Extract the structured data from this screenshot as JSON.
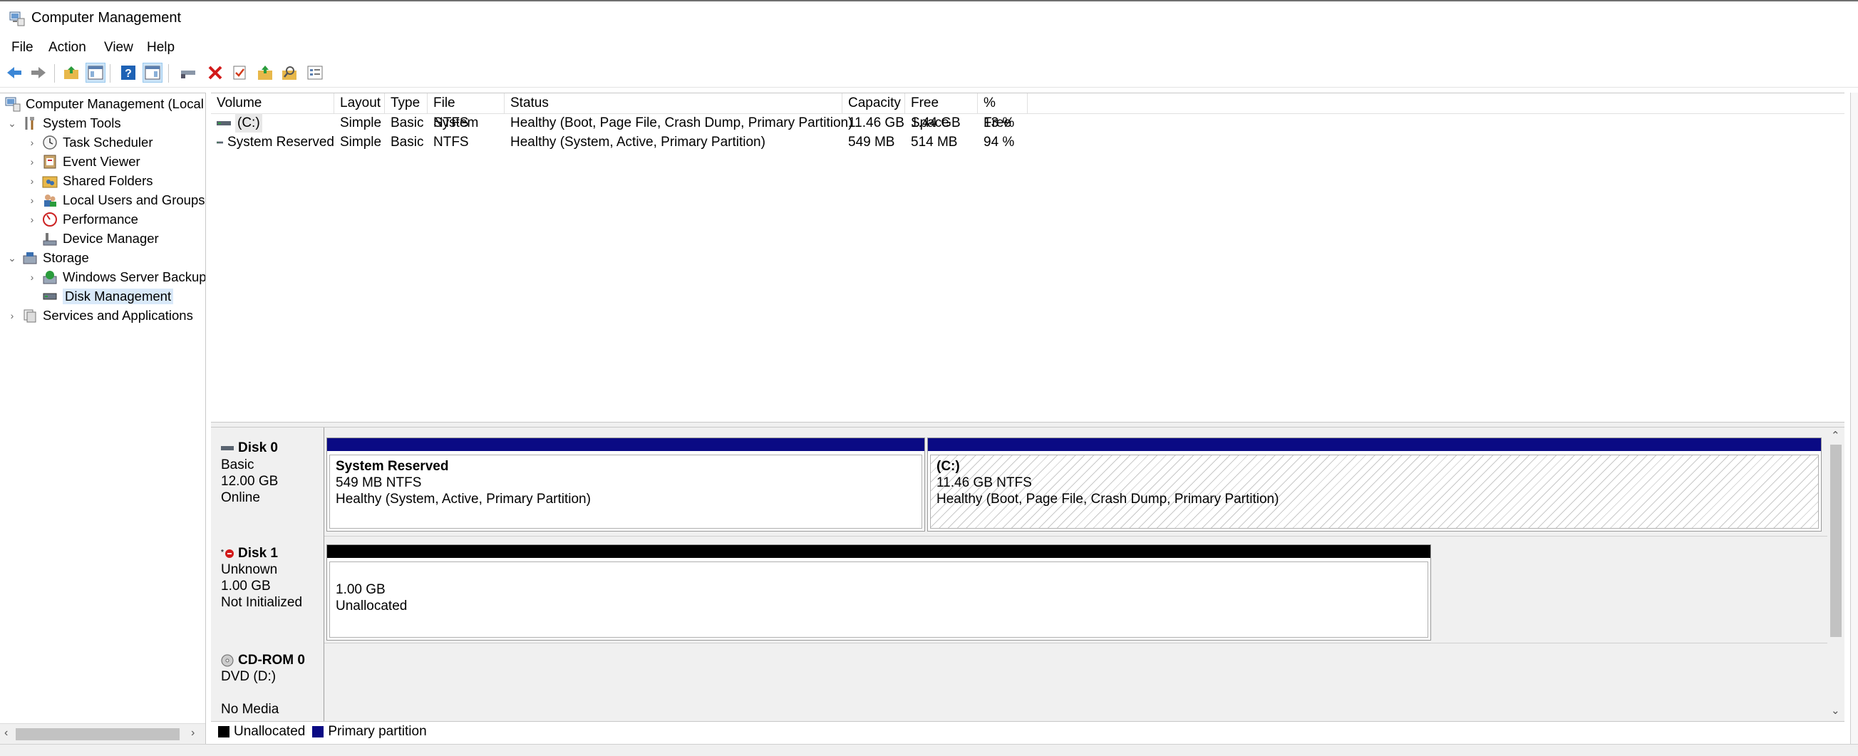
{
  "window": {
    "title": "Computer Management"
  },
  "menu": [
    "File",
    "Action",
    "View",
    "Help"
  ],
  "toolbar": {
    "buttons": [
      "back-icon",
      "forward-icon",
      "up-folder-icon",
      "show-hide-tree-icon",
      "help-icon",
      "show-hide-action-pane-icon",
      "connect-icon",
      "delete-icon",
      "check-icon",
      "export-folder-icon",
      "find-folder-icon",
      "properties-icon"
    ]
  },
  "tree": {
    "root": "Computer Management (Local",
    "system_tools": "System Tools",
    "task_scheduler": "Task Scheduler",
    "event_viewer": "Event Viewer",
    "shared_folders": "Shared Folders",
    "local_users": "Local Users and Groups",
    "performance": "Performance",
    "device_manager": "Device Manager",
    "storage": "Storage",
    "windows_backup": "Windows Server Backup",
    "disk_management": "Disk Management",
    "services": "Services and Applications"
  },
  "volumes": {
    "columns": [
      "Volume",
      "Layout",
      "Type",
      "File System",
      "Status",
      "Capacity",
      "Free Space",
      "% Free"
    ],
    "rows": [
      {
        "volume": "(C:)",
        "layout": "Simple",
        "type": "Basic",
        "fs": "NTFS",
        "status": "Healthy (Boot, Page File, Crash Dump, Primary Partition)",
        "capacity": "11.46 GB",
        "free": "1.44 GB",
        "pct": "13 %"
      },
      {
        "volume": "System Reserved",
        "layout": "Simple",
        "type": "Basic",
        "fs": "NTFS",
        "status": "Healthy (System, Active, Primary Partition)",
        "capacity": "549 MB",
        "free": "514 MB",
        "pct": "94 %"
      }
    ]
  },
  "disks": {
    "disk0": {
      "name": "Disk 0",
      "type": "Basic",
      "size": "12.00 GB",
      "status": "Online",
      "p1": {
        "name": "System Reserved",
        "size": "549 MB NTFS",
        "status": "Healthy (System, Active, Primary Partition)"
      },
      "p2": {
        "name": "(C:)",
        "size": "11.46 GB NTFS",
        "status": "Healthy (Boot, Page File, Crash Dump, Primary Partition)"
      }
    },
    "disk1": {
      "name": "Disk 1",
      "type": "Unknown",
      "size": "1.00 GB",
      "status": "Not Initialized",
      "p1": {
        "size": "1.00 GB",
        "status": "Unallocated"
      }
    },
    "cdrom0": {
      "name": "CD-ROM 0",
      "drive": "DVD (D:)",
      "status": "No Media"
    }
  },
  "legend": {
    "unallocated": "Unallocated",
    "primary": "Primary partition"
  },
  "colors": {
    "primary": "#0a0a84",
    "unallocated": "#000000",
    "selection": "#d9e9f9"
  }
}
